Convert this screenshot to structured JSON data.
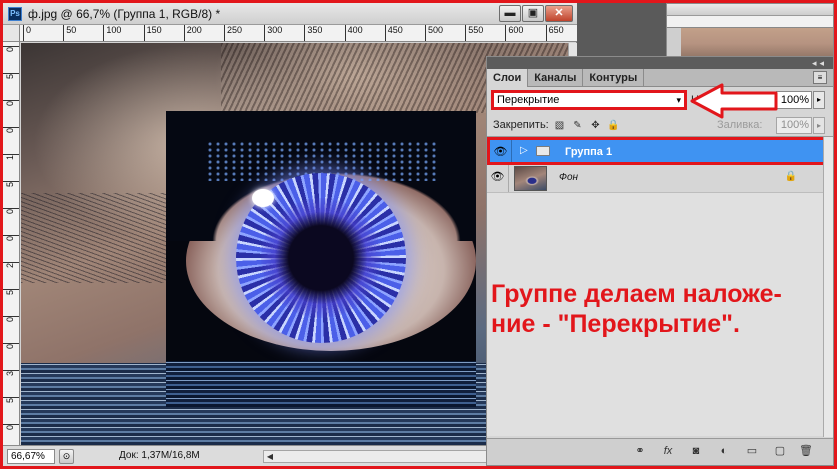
{
  "document": {
    "app_icon": "Ps",
    "title": "ф.jpg @ 66,7% (Группа 1, RGB/8) *",
    "minimize_glyph": "▬",
    "maximize_glyph": "▣",
    "close_glyph": "✕",
    "ruler_h_labels": [
      "0",
      "50",
      "100",
      "150",
      "200",
      "250",
      "300",
      "350",
      "400",
      "450",
      "500",
      "550",
      "600",
      "650"
    ],
    "ruler_v_labels": [
      "0",
      "5",
      "0",
      "0",
      "1",
      "5",
      "0",
      "0",
      "2",
      "5",
      "0",
      "0",
      "3",
      "5",
      "0"
    ],
    "status": {
      "zoom": "66,67%",
      "doc_size": "Док: 1,37M/16,8M",
      "left_arrow": "◀",
      "right_arrow": "▶"
    }
  },
  "layers_panel": {
    "collapse_glyph": "◂◂",
    "tabs": [
      {
        "label": "Слои",
        "active": true
      },
      {
        "label": "Каналы",
        "active": false
      },
      {
        "label": "Контуры",
        "active": false
      }
    ],
    "menu_glyph": "≡",
    "blend_mode": "Перекрытие",
    "blend_arrow": "▾",
    "opacity_label": "Н",
    "opacity_value": "100%",
    "lock_label": "Закрепить:",
    "fill_label": "Заливка:",
    "fill_value": "100%",
    "stepper_glyph": "▸",
    "layers": [
      {
        "name": "Группа 1",
        "type": "group",
        "selected": true,
        "visible_glyph": "👁",
        "expand_glyph": "▷"
      },
      {
        "name": "Фон",
        "type": "background",
        "selected": false,
        "visible_glyph": "👁",
        "lock_glyph": "🔒"
      }
    ],
    "bottom_buttons": [
      "⚭",
      "fx",
      "◙",
      "◐",
      "▭",
      "▢",
      "🗑"
    ],
    "annotation": "Группе делаем наложе- ние - \"Перекрытие\"."
  },
  "colors": {
    "highlight_red": "#e2161b",
    "selected_layer": "#3f93f2",
    "panel_bg": "#d6d6d6"
  }
}
